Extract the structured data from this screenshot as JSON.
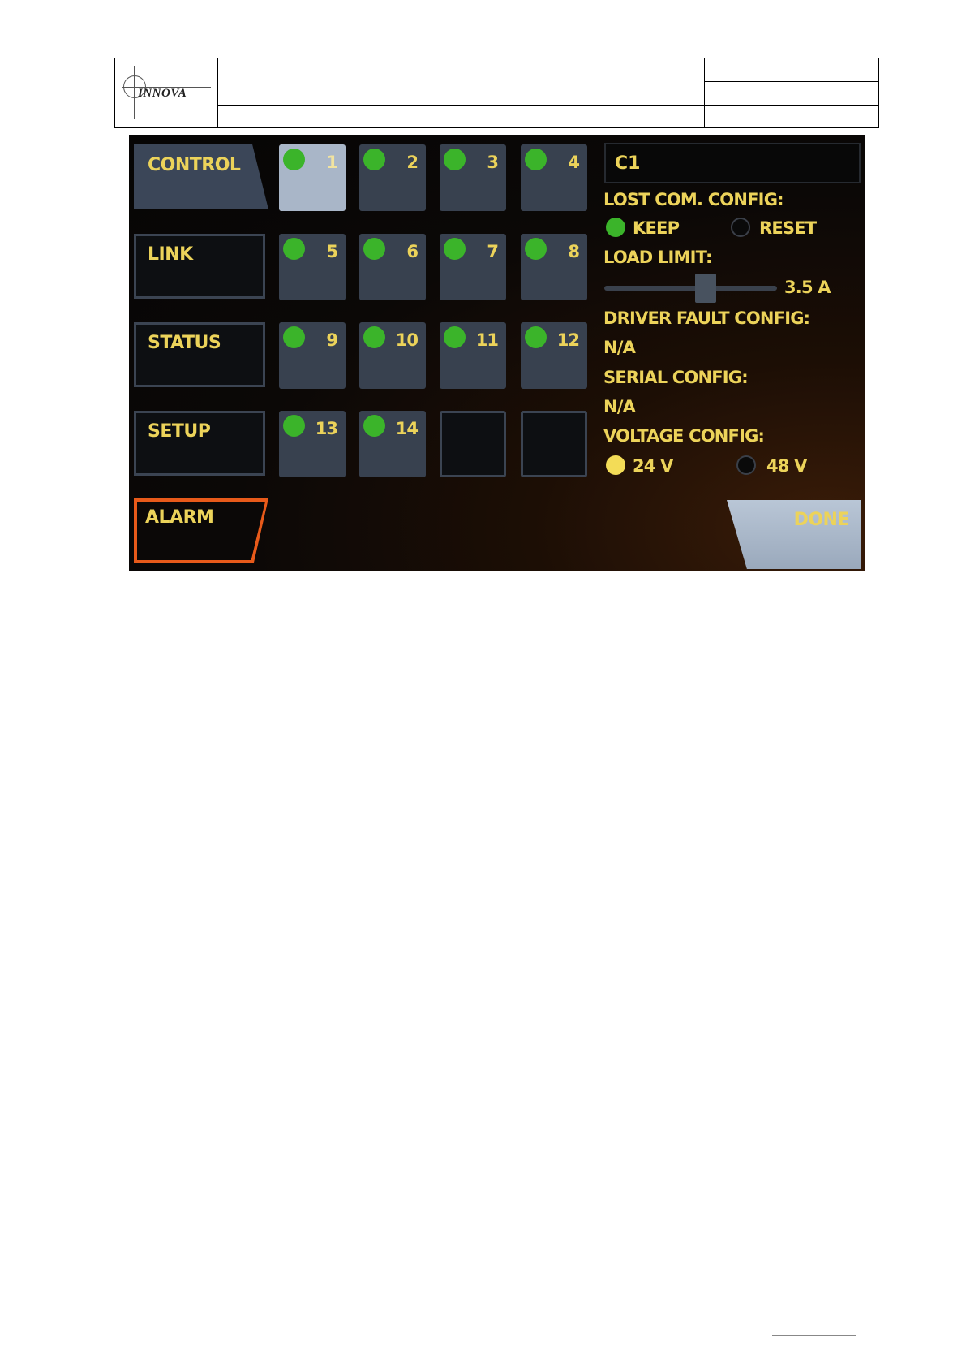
{
  "header": {
    "logo_text": "INNOVA"
  },
  "hmi": {
    "nav": {
      "control": "CONTROL",
      "link": "LINK",
      "status": "STATUS",
      "setup": "SETUP",
      "alarm": "ALARM"
    },
    "tiles": [
      {
        "label": "1",
        "led": true,
        "selected": true
      },
      {
        "label": "2",
        "led": true,
        "selected": false
      },
      {
        "label": "3",
        "led": true,
        "selected": false
      },
      {
        "label": "4",
        "led": true,
        "selected": false
      },
      {
        "label": "5",
        "led": true,
        "selected": false
      },
      {
        "label": "6",
        "led": true,
        "selected": false
      },
      {
        "label": "7",
        "led": true,
        "selected": false
      },
      {
        "label": "8",
        "led": true,
        "selected": false
      },
      {
        "label": "9",
        "led": true,
        "selected": false
      },
      {
        "label": "10",
        "led": true,
        "selected": false
      },
      {
        "label": "11",
        "led": true,
        "selected": false
      },
      {
        "label": "12",
        "led": true,
        "selected": false
      },
      {
        "label": "13",
        "led": true,
        "selected": false
      },
      {
        "label": "14",
        "led": true,
        "selected": false
      },
      {
        "label": "",
        "led": false,
        "selected": false
      },
      {
        "label": "",
        "led": false,
        "selected": false
      }
    ],
    "config": {
      "channel_name": "C1",
      "lost_com_label": "LOST COM. CONFIG:",
      "lost_com_options": [
        "KEEP",
        "RESET"
      ],
      "lost_com_selected": "KEEP",
      "load_limit_label": "LOAD LIMIT:",
      "load_limit_value": "3.5 A",
      "load_limit_fraction": 0.6,
      "driver_fault_label": "DRIVER FAULT CONFIG:",
      "driver_fault_value": "N/A",
      "serial_label": "SERIAL CONFIG:",
      "serial_value": "N/A",
      "voltage_label": "VOLTAGE CONFIG:",
      "voltage_options": [
        "24 V",
        "48 V"
      ],
      "voltage_selected": "24 V"
    },
    "done_label": "DONE",
    "colors": {
      "text_yellow": "#ecd35a",
      "led_green": "#3bb42a",
      "alarm_orange": "#e85a1a"
    }
  }
}
